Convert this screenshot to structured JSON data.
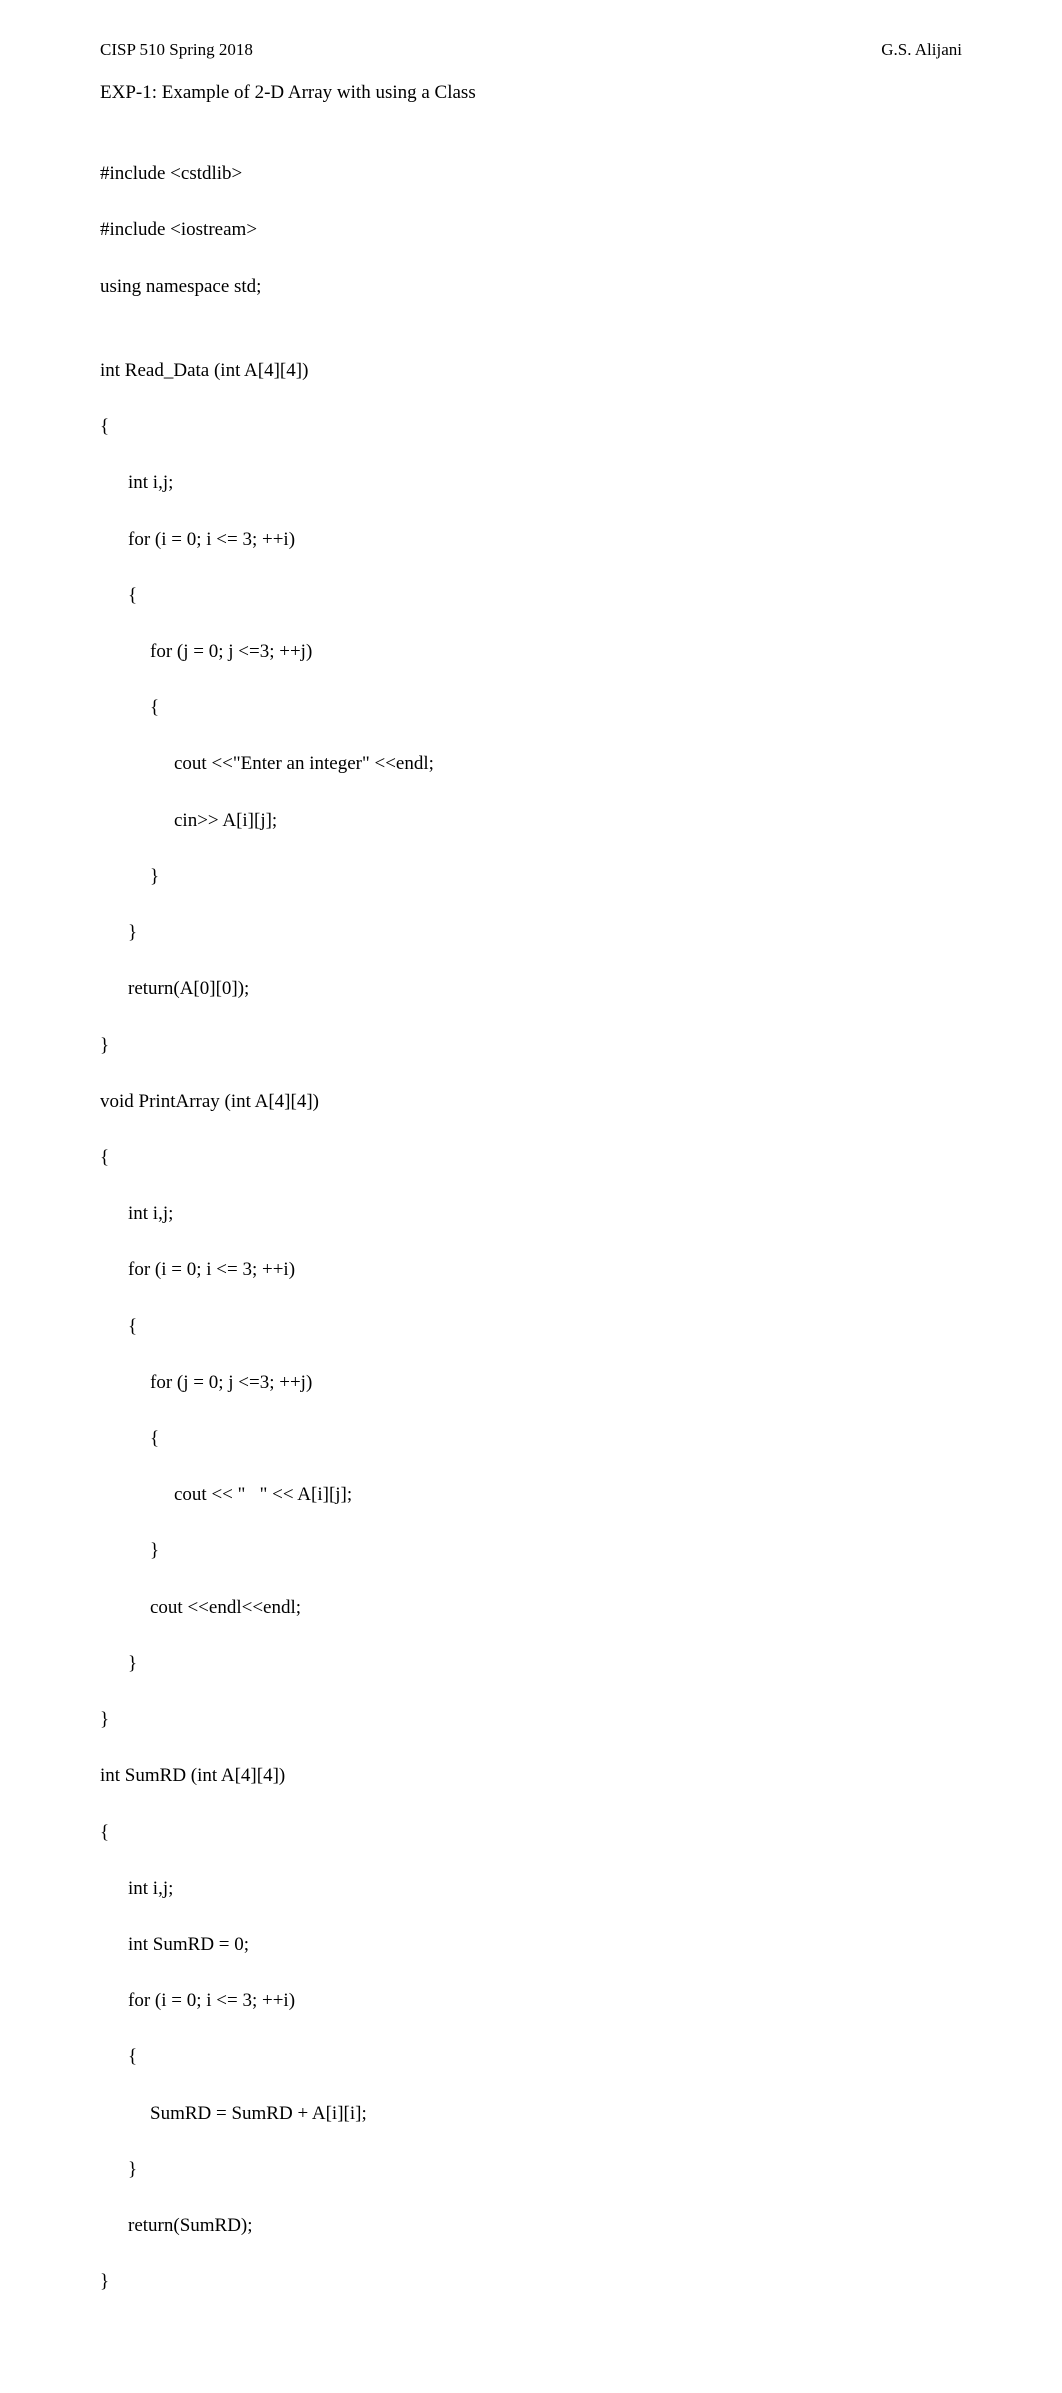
{
  "header": {
    "left": "CISP 510 Spring 2018",
    "right": "G.S. Alijani"
  },
  "title": "EXP-1: Example of 2-D Array with using a Class",
  "code": {
    "l01": "#include <cstdlib>",
    "l02": "#include <iostream>",
    "l03": "using namespace std;",
    "l04": "",
    "l05": "int Read_Data (int A[4][4])",
    "l06": "{",
    "l07": "int i,j;",
    "l08": "for (i = 0; i <= 3; ++i)",
    "l09": "{",
    "l10": "for (j = 0; j <=3; ++j)",
    "l11": "{",
    "l12": "cout <<\"Enter an integer\" <<endl;",
    "l13": "cin>> A[i][j];",
    "l14": "}",
    "l15": "}",
    "l16": "return(A[0][0]);",
    "l17": "}",
    "l18": "void PrintArray (int A[4][4])",
    "l19": "{",
    "l20": "int i,j;",
    "l21": "for (i = 0; i <= 3; ++i)",
    "l22": "{",
    "l23": "for (j = 0; j <=3; ++j)",
    "l24": "{",
    "l25": "cout << \"   \" << A[i][j];",
    "l26": "}",
    "l27": "cout <<endl<<endl;",
    "l28": "}",
    "l29": "}",
    "l30": "int SumRD (int A[4][4])",
    "l31": "{",
    "l32": "int i,j;",
    "l33": "int SumRD = 0;",
    "l34": "for (i = 0; i <= 3; ++i)",
    "l35": "{",
    "l36": "SumRD = SumRD + A[i][i];",
    "l37": "}",
    "l38": "return(SumRD);",
    "l39": "}"
  }
}
